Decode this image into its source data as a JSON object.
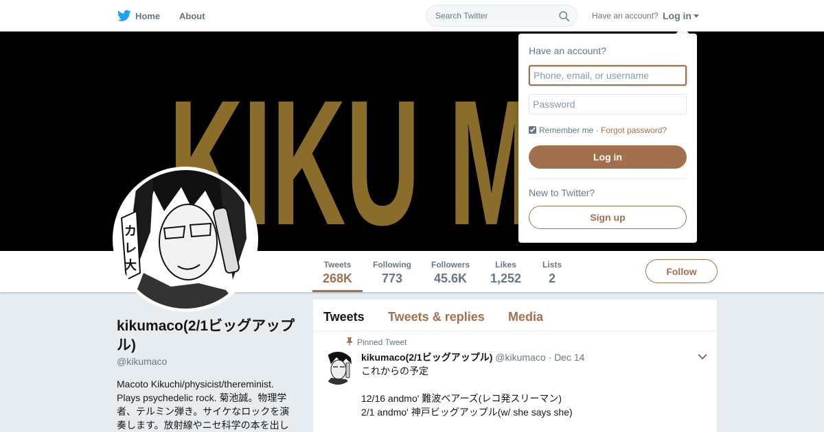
{
  "topbar": {
    "home_label": "Home",
    "about_label": "About",
    "search_placeholder": "Search Twitter",
    "have_account": "Have an account?",
    "login_label": "Log in"
  },
  "banner": {
    "text": "KIKU MA",
    "background_color": "#000000",
    "letter_color": "#8a6d2a"
  },
  "profile": {
    "name": "kikumaco(2/1ビッグアップル)",
    "handle": "@kikumaco",
    "bio_lines": [
      "Macoto Kikuchi/physicist/thereminist.",
      "Plays psychedelic rock. 菊池誠。物理学",
      "者、テルミン弾き。サイケなロックを演",
      "奏します。放射線やニセ科学の本を出し"
    ]
  },
  "stats": [
    {
      "label": "Tweets",
      "value": "268K",
      "active": true
    },
    {
      "label": "Following",
      "value": "773",
      "active": false
    },
    {
      "label": "Followers",
      "value": "45.6K",
      "active": false
    },
    {
      "label": "Likes",
      "value": "1,252",
      "active": false
    },
    {
      "label": "Lists",
      "value": "2",
      "active": false
    }
  ],
  "follow_label": "Follow",
  "timeline": {
    "tabs": [
      {
        "label": "Tweets",
        "active": true
      },
      {
        "label": "Tweets & replies",
        "active": false
      },
      {
        "label": "Media",
        "active": false
      }
    ],
    "pinned_label": "Pinned Tweet",
    "tweet": {
      "name": "kikumaco(2/1ビッグアップル)",
      "handle": "@kikumaco",
      "separator": "·",
      "date": "Dec 14",
      "lines": [
        "これからの予定",
        "",
        "12/16 andmo' 難波ベアーズ(レコ発スリーマン)",
        "2/1 andmo' 神戸ビッグアップル(w/ she says she)"
      ]
    }
  },
  "login_dropdown": {
    "title": "Have an account?",
    "username_placeholder": "Phone, email, or username",
    "password_placeholder": "Password",
    "remember_label": "Remember me",
    "separator": "·",
    "forgot_label": "Forgot password?",
    "remember_checked": true,
    "login_button": "Log in",
    "new_label": "New to Twitter?",
    "signup_button": "Sign up"
  },
  "colors": {
    "accent": "#a3704d",
    "twitter_blue": "#1da1f2",
    "muted": "#657786"
  },
  "icons": [
    "twitter-bird-icon",
    "search-icon",
    "caret-down-icon",
    "pin-icon",
    "chevron-down-icon"
  ]
}
